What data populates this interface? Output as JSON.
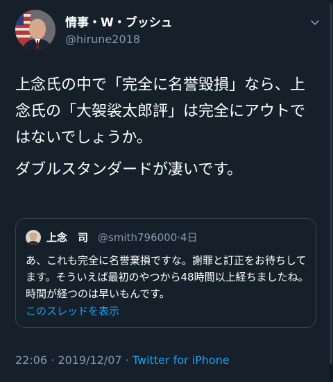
{
  "tweet": {
    "author": {
      "display_name": "情事・W・ブッシュ",
      "handle": "@hirune2018"
    },
    "text_lines": [
      "上念氏の中で「完全に名誉毀損」なら、上念氏の「大袈裟太郎評」は完全にアウトではないでしょうか。",
      "ダブルスタンダードが凄いです。"
    ],
    "time": "22:06",
    "separator": "·",
    "date": "2019/12/07",
    "source": "Twitter for iPhone"
  },
  "quoted_tweet": {
    "display_name": "上念　司",
    "handle": "@smith796000",
    "separator": "·",
    "time_ago": "4日",
    "text": "あ、これも完全に名誉棄損ですな。謝罪と訂正をお待ちしてます。そういえば最初のやつから48時間以上経ちましたね。時間が経つのは早いもんです。",
    "thread_link": "このスレッドを表示"
  },
  "colors": {
    "background": "#15202b",
    "text": "#ffffff",
    "muted": "#8899a6",
    "link": "#1da1f2",
    "border": "#38444d"
  },
  "icons": {
    "avatar": "avatar-flag-portrait",
    "caret": "chevron-down-icon",
    "quoted_avatar": "avatar-portrait"
  }
}
